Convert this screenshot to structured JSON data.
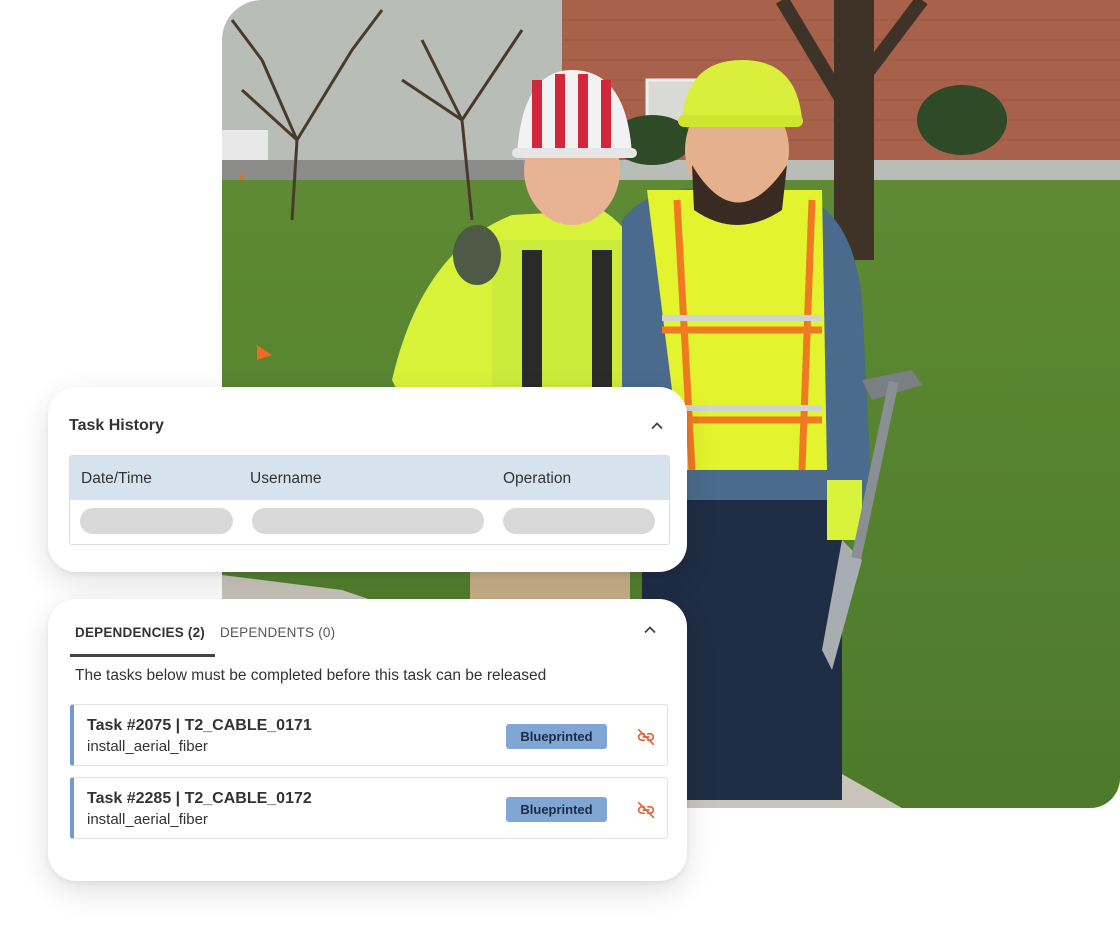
{
  "task_history": {
    "title": "Task History",
    "columns": [
      "Date/Time",
      "Username",
      "Operation"
    ]
  },
  "dependencies": {
    "tabs": [
      {
        "label": "DEPENDENCIES (2)",
        "active": true
      },
      {
        "label": "DEPENDENTS (0)",
        "active": false
      }
    ],
    "description": "The tasks below must be completed before this task can be released",
    "items": [
      {
        "title": "Task #2075 | T2_CABLE_0171",
        "subtitle": "install_aerial_fiber",
        "status": "Blueprinted"
      },
      {
        "title": "Task #2285 | T2_CABLE_0172",
        "subtitle": "install_aerial_fiber",
        "status": "Blueprinted"
      }
    ]
  },
  "icons": {
    "collapse": "chevron-up-icon",
    "remove_dependency": "unlink-icon"
  },
  "colors": {
    "table_header_bg": "#d6e3ef",
    "status_badge_bg": "#7fa6d4",
    "item_accent": "#6f9bd0",
    "unlink_icon": "#e0643a"
  }
}
